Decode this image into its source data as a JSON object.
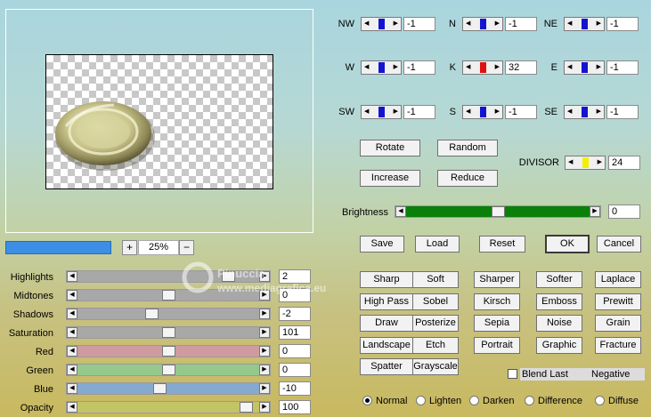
{
  "zoom": {
    "minus": "−",
    "plus": "+",
    "value": "25%"
  },
  "progress_fraction": 1.0,
  "sliders": [
    {
      "label": "Highlights",
      "value": "2",
      "pos": 0.86,
      "color": "#a8a8a8"
    },
    {
      "label": "Midtones",
      "value": "0",
      "pos": 0.5,
      "color": "#a8a8a8"
    },
    {
      "label": "Shadows",
      "value": "-2",
      "pos": 0.4,
      "color": "#a8a8a8"
    },
    {
      "label": "Saturation",
      "value": "101",
      "pos": 0.5,
      "color": "#a8a8a8"
    },
    {
      "label": "Red",
      "value": "0",
      "pos": 0.5,
      "color": "#cf9ba0"
    },
    {
      "label": "Green",
      "value": "0",
      "pos": 0.5,
      "color": "#95c98b"
    },
    {
      "label": "Blue",
      "value": "-10",
      "pos": 0.45,
      "color": "#86a9cf"
    },
    {
      "label": "Opacity",
      "value": "100",
      "pos": 0.97,
      "color": "#c4c466"
    }
  ],
  "matrix": [
    {
      "label": "NW",
      "value": "-1"
    },
    {
      "label": "N",
      "value": "-1"
    },
    {
      "label": "NE",
      "value": "-1"
    },
    {
      "label": "W",
      "value": "-1"
    },
    {
      "label": "K",
      "value": "32"
    },
    {
      "label": "E",
      "value": "-1"
    },
    {
      "label": "SW",
      "value": "-1"
    },
    {
      "label": "S",
      "value": "-1"
    },
    {
      "label": "SE",
      "value": "-1"
    }
  ],
  "matrix_colors": {
    "default": "#1414d0",
    "center": "#e01010",
    "divisor": "#f0f000"
  },
  "buttons": {
    "rotate": "Rotate",
    "random": "Random",
    "increase": "Increase",
    "reduce": "Reduce",
    "save": "Save",
    "load": "Load",
    "reset": "Reset",
    "ok": "OK",
    "cancel": "Cancel"
  },
  "divisor": {
    "label": "DIVISOR",
    "value": "24"
  },
  "brightness": {
    "label": "Brightness",
    "value": "0",
    "pos": 0.5,
    "color": "#0a800a"
  },
  "filters": [
    "Sharp",
    "Soft",
    "Sharper",
    "Softer",
    "Laplace",
    "High Pass",
    "Sobel",
    "Kirsch",
    "Emboss",
    "Prewitt",
    "Draw",
    "Posterize",
    "Sepia",
    "Noise",
    "Grain",
    "Landscape",
    "Etch",
    "Portrait",
    "Graphic",
    "Fracture",
    "Spatter",
    "Grayscale"
  ],
  "blend_last": "Blend Last",
  "negative": "Negative",
  "modes": [
    {
      "label": "Normal",
      "selected": true
    },
    {
      "label": "Lighten",
      "selected": false
    },
    {
      "label": "Darken",
      "selected": false
    },
    {
      "label": "Difference",
      "selected": false
    },
    {
      "label": "Diffuse",
      "selected": false
    }
  ],
  "watermark_text": [
    "Pinuccia",
    "www.mediagrafica.eu"
  ]
}
